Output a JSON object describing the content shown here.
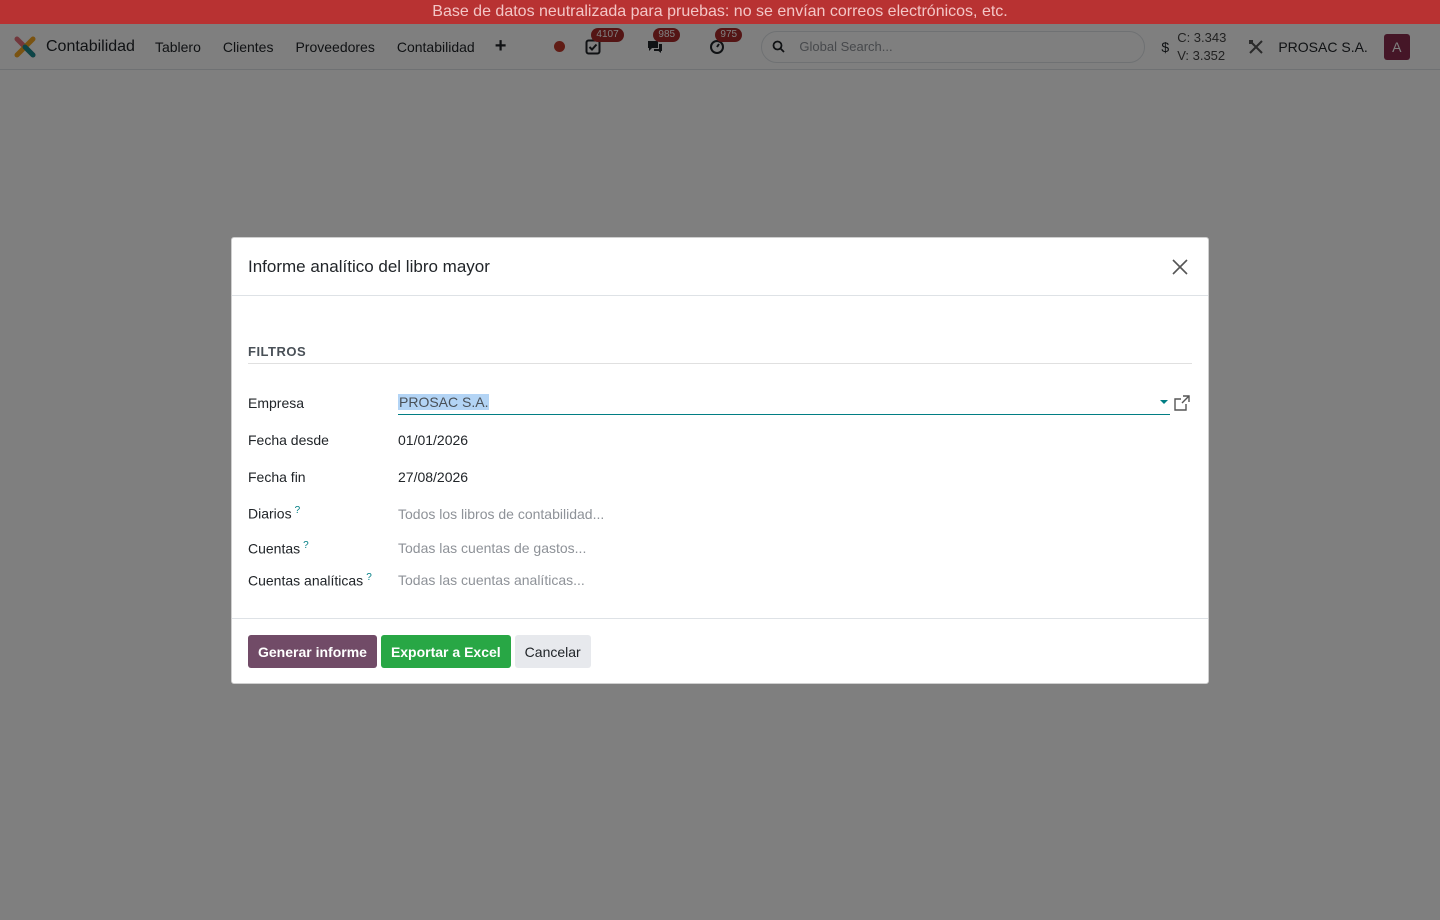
{
  "banner": {
    "text": "Base de datos neutralizada para pruebas: no se envían correos electrónicos, etc."
  },
  "navbar": {
    "app_name": "Contabilidad",
    "menu": [
      "Tablero",
      "Clientes",
      "Proveedores",
      "Contabilidad"
    ],
    "plus": "+",
    "badges": {
      "activities": "4107",
      "messages": "985",
      "timers": "975"
    },
    "search_placeholder": "Global Search...",
    "currency_symbol": "$",
    "rate_buy": "C: 3.343",
    "rate_sell": "V: 3.352",
    "company": "PROSAC S.A.",
    "avatar_letter": "A"
  },
  "modal": {
    "title": "Informe analítico del libro mayor",
    "section": "FILTROS",
    "fields": {
      "empresa_label": "Empresa",
      "empresa_value": "PROSAC S.A.",
      "fecha_desde_label": "Fecha desde",
      "fecha_desde_value": "01/01/2026",
      "fecha_fin_label": "Fecha fin",
      "fecha_fin_value": "27/08/2026",
      "diarios_label": "Diarios",
      "diarios_placeholder": "Todos los libros de contabilidad...",
      "cuentas_label": "Cuentas",
      "cuentas_placeholder": "Todas las cuentas de gastos...",
      "analiticas_label": "Cuentas analíticas",
      "analiticas_placeholder": "Todas las cuentas analíticas...",
      "help_mark": "?"
    },
    "buttons": {
      "generate": "Generar informe",
      "export": "Exportar a Excel",
      "cancel": "Cancelar"
    }
  },
  "colors": {
    "primary": "#714b67",
    "success": "#28a745",
    "banner": "#b83232",
    "accent": "#017e84"
  }
}
